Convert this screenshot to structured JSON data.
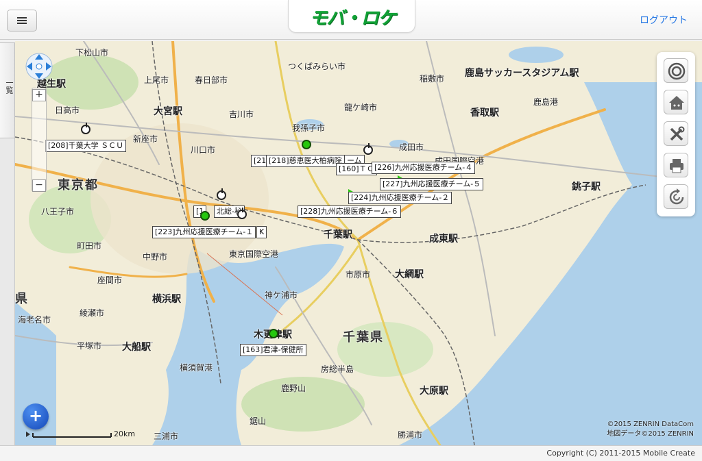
{
  "header": {
    "logo_text": "モバ・ロケ",
    "logout_label": "ログアウト"
  },
  "side_tab": {
    "label": "一覧"
  },
  "map": {
    "places": [
      {
        "text": "越生駅",
        "cls": "big"
      },
      {
        "text": "下松山市",
        "cls": ""
      },
      {
        "text": "日高市",
        "cls": ""
      },
      {
        "text": "上尾市",
        "cls": ""
      },
      {
        "text": "春日部市",
        "cls": ""
      },
      {
        "text": "つくばみらい市",
        "cls": ""
      },
      {
        "text": "大宮駅",
        "cls": "big"
      },
      {
        "text": "吉川市",
        "cls": ""
      },
      {
        "text": "我孫子市",
        "cls": ""
      },
      {
        "text": "龍ケ崎市",
        "cls": ""
      },
      {
        "text": "稲敷市",
        "cls": ""
      },
      {
        "text": "鹿島サッカースタジアム駅",
        "cls": "big"
      },
      {
        "text": "鹿島港",
        "cls": ""
      },
      {
        "text": "香取駅",
        "cls": "big"
      },
      {
        "text": "新座市",
        "cls": ""
      },
      {
        "text": "川口市",
        "cls": ""
      },
      {
        "text": "成田市",
        "cls": ""
      },
      {
        "text": "成田国際空港",
        "cls": ""
      },
      {
        "text": "東京都",
        "cls": "huge"
      },
      {
        "text": "銚子駅",
        "cls": "big"
      },
      {
        "text": "八王子市",
        "cls": ""
      },
      {
        "text": "町田市",
        "cls": ""
      },
      {
        "text": "東京国際空港",
        "cls": ""
      },
      {
        "text": "千葉駅",
        "cls": "big"
      },
      {
        "text": "成東駅",
        "cls": "big"
      },
      {
        "text": "市原市",
        "cls": ""
      },
      {
        "text": "大網駅",
        "cls": "big"
      },
      {
        "text": "座間市",
        "cls": ""
      },
      {
        "text": "横浜駅",
        "cls": "big"
      },
      {
        "text": "神ケ浦市",
        "cls": ""
      },
      {
        "text": "海老名市",
        "cls": ""
      },
      {
        "text": "綾瀬市",
        "cls": ""
      },
      {
        "text": "木更津駅",
        "cls": "big"
      },
      {
        "text": "千葉県",
        "cls": "huge"
      },
      {
        "text": "平塚市",
        "cls": ""
      },
      {
        "text": "大船駅",
        "cls": "big"
      },
      {
        "text": "横須賀港",
        "cls": ""
      },
      {
        "text": "房総半島",
        "cls": ""
      },
      {
        "text": "鹿野山",
        "cls": ""
      },
      {
        "text": "大原駅",
        "cls": "big"
      },
      {
        "text": "鋸山",
        "cls": ""
      },
      {
        "text": "三浦市",
        "cls": ""
      },
      {
        "text": "勝浦市",
        "cls": ""
      },
      {
        "text": "県",
        "cls": "huge"
      },
      {
        "text": "中野市",
        "cls": ""
      }
    ],
    "markers": [
      {
        "label": "[208]千葉大学 ＳＣＵ"
      },
      {
        "label": "[216"
      },
      {
        "label": "[218]慈恵医大柏病院"
      },
      {
        "label": "ーム"
      },
      {
        "label": "[160]ＴＣ"
      },
      {
        "label": "[226]九州応援医療チーム-４"
      },
      {
        "label": "[227]九州応援医療チーム-５"
      },
      {
        "label": "[224]九州応援医療チーム-２"
      },
      {
        "label": "[228]九州応援医療チーム-６"
      },
      {
        "label": "[1"
      },
      {
        "label": "北総-秘"
      },
      {
        "label": "K"
      },
      {
        "label": "[223]九州応援医療チーム-１"
      },
      {
        "label": "[163]君津-保健所"
      }
    ],
    "scale_label": "20km",
    "attribution_line1": "©2015 ZENRIN DataCom",
    "attribution_line2": "地図データ©2015 ZENRIN"
  },
  "footer": {
    "copyright": "Copyright (C) 2011-2015 Mobile Create"
  },
  "icons": {
    "menu": "hamburger-icon",
    "pan": "pan-arrows-icon",
    "locate": "target-icon",
    "home": "home-icon",
    "tools": "tools-icon",
    "print": "print-icon",
    "refresh": "refresh-icon",
    "add": "plus-icon"
  }
}
